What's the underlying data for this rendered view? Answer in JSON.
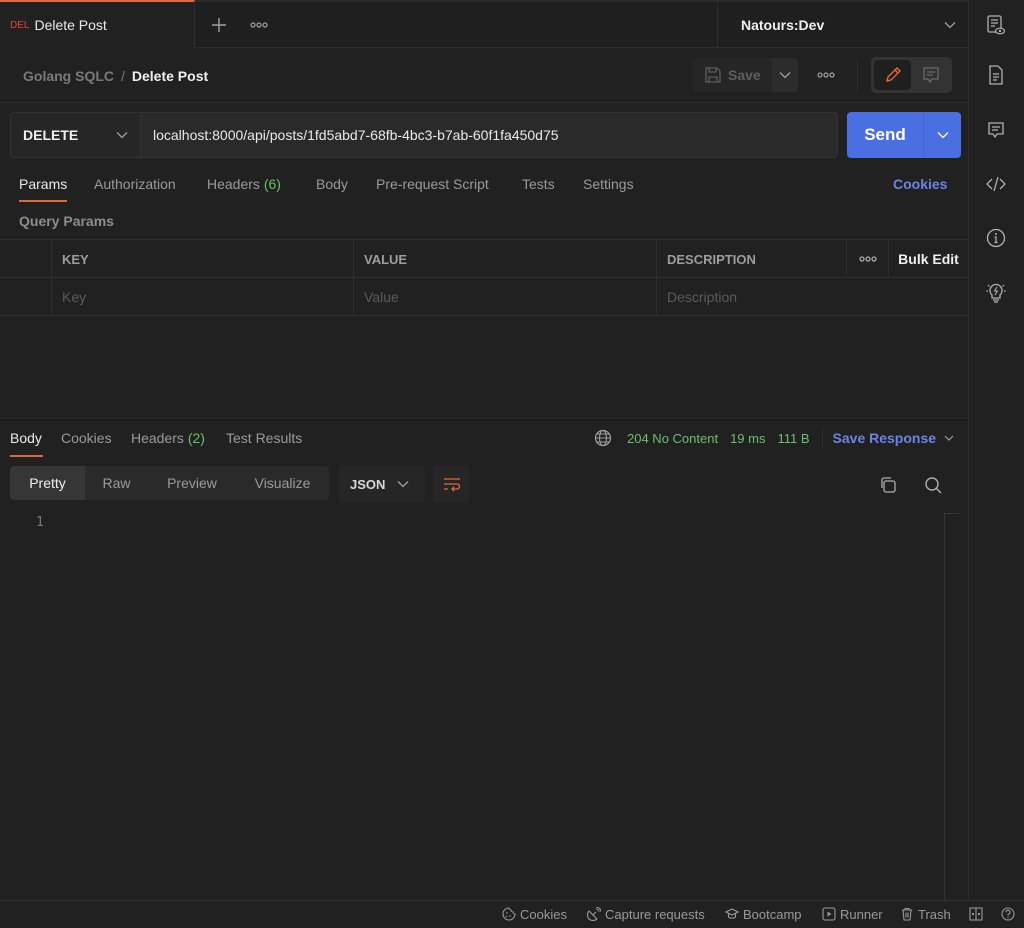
{
  "tab": {
    "method_badge": "DEL",
    "title": "Delete Post"
  },
  "environment": {
    "selected": "Natours:Dev"
  },
  "breadcrumb": {
    "parent": "Golang SQLC",
    "separator": "/",
    "current": "Delete Post"
  },
  "toolbar": {
    "save_label": "Save"
  },
  "request": {
    "method": "DELETE",
    "url": "localhost:8000/api/posts/1fd5abd7-68fb-4bc3-b7ab-60f1fa450d75",
    "send_label": "Send"
  },
  "request_tabs": [
    {
      "label": "Params",
      "count": null
    },
    {
      "label": "Authorization",
      "count": null
    },
    {
      "label": "Headers",
      "count": "(6)"
    },
    {
      "label": "Body",
      "count": null
    },
    {
      "label": "Pre-request Script",
      "count": null
    },
    {
      "label": "Tests",
      "count": null
    },
    {
      "label": "Settings",
      "count": null
    }
  ],
  "cookies_link": "Cookies",
  "query_params": {
    "title": "Query Params",
    "columns": [
      "KEY",
      "VALUE",
      "DESCRIPTION"
    ],
    "bulk_edit_label": "Bulk Edit",
    "placeholders": {
      "key": "Key",
      "value": "Value",
      "description": "Description"
    }
  },
  "response_tabs": [
    {
      "label": "Body",
      "count": null
    },
    {
      "label": "Cookies",
      "count": null
    },
    {
      "label": "Headers",
      "count": "(2)"
    },
    {
      "label": "Test Results",
      "count": null
    }
  ],
  "response_meta": {
    "status": "204 No Content",
    "time": "19 ms",
    "size": "111 B",
    "save_response_label": "Save Response",
    "status_color": "#6cbf6a"
  },
  "response_view": {
    "modes": [
      "Pretty",
      "Raw",
      "Preview",
      "Visualize"
    ],
    "active_mode": "Pretty",
    "format": "JSON",
    "line_numbers": [
      "1"
    ]
  },
  "footer": {
    "items": [
      "Cookies",
      "Capture requests",
      "Bootcamp",
      "Runner",
      "Trash"
    ]
  },
  "colors": {
    "accent": "#e0693a",
    "primary": "#4a6fe0",
    "link": "#6c84e6",
    "delete_method": "#e0473b"
  }
}
